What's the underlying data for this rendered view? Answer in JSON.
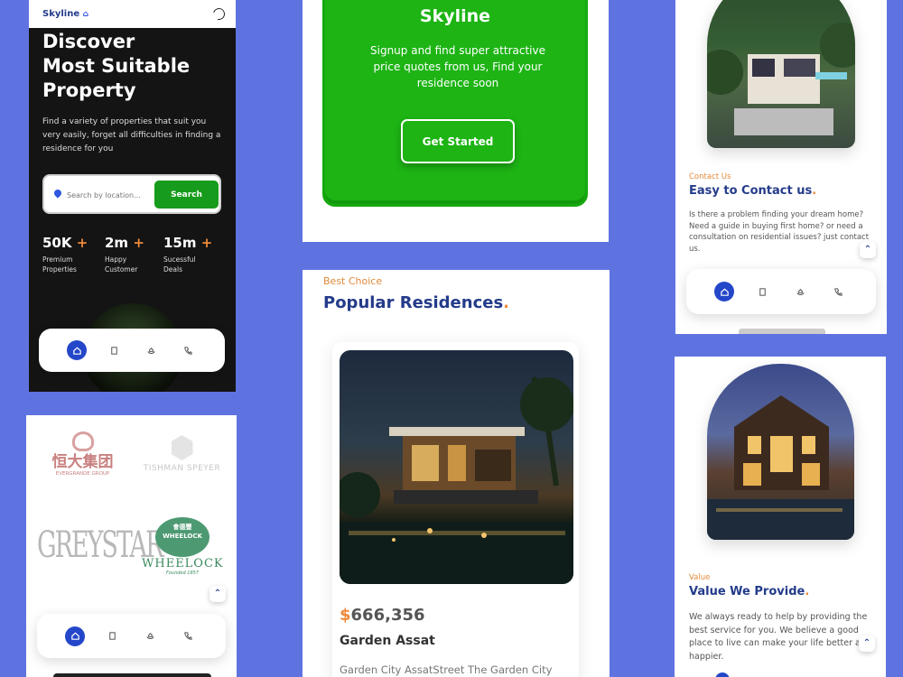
{
  "hero": {
    "brand": "Skyline",
    "title_lines": [
      "Discover",
      "Most Suitable",
      "Property"
    ],
    "description": "Find a variety of properties that suit you very easily, forget all difficulties in finding a residence for you",
    "search_placeholder": "Search by location...",
    "search_button": "Search",
    "stats": [
      {
        "num": "50K",
        "plus": "+",
        "label1": "Premium",
        "label2": "Properties"
      },
      {
        "num": "2m",
        "plus": "+",
        "label1": "Happy",
        "label2": "Customer"
      },
      {
        "num": "15m",
        "plus": "+",
        "label1": "Sucessful",
        "label2": "Deals"
      }
    ]
  },
  "nav_icons": [
    "home-icon",
    "building-icon",
    "hand-house-icon",
    "phone-icon"
  ],
  "signup": {
    "title": "Skyline",
    "text": "Signup and find super attractive price quotes from us, Find your residence soon",
    "button": "Get Started"
  },
  "popular": {
    "eyebrow": "Best Choice",
    "title": "Popular Residences",
    "dot": ".",
    "price_currency": "$",
    "price": "666,356",
    "name": "Garden Assat",
    "address": "Garden City AssatStreet The Garden City"
  },
  "logos": {
    "evergrande_cn": "恒大集团",
    "evergrande_en": "EVERGRANDE GROUP",
    "tishman": "TISHMAN SPEYER",
    "greystar": "GREYSTAR",
    "wheelock_badge": "WHEELOCK",
    "wheelock_cn": "會德豐",
    "wheelock": "WHEELOCK",
    "wheelock_since": "Founded 1857"
  },
  "contact": {
    "eyebrow": "Contact Us",
    "title": "Easy to Contact us",
    "dot": ".",
    "text": "Is there a problem finding your dream home? Need a guide in buying first home? or need a consultation on residential issues? just contact us."
  },
  "value": {
    "eyebrow": "Value",
    "title": "Value We Provide",
    "dot": ".",
    "text": "We always ready to help by providing the best service for you. We believe a good place to live can make your life better and happier."
  },
  "colors": {
    "green": "#1db414",
    "navy": "#233b8a",
    "accent": "#f08a3a",
    "blue_active": "#2447c9",
    "background": "#5f73e0"
  }
}
